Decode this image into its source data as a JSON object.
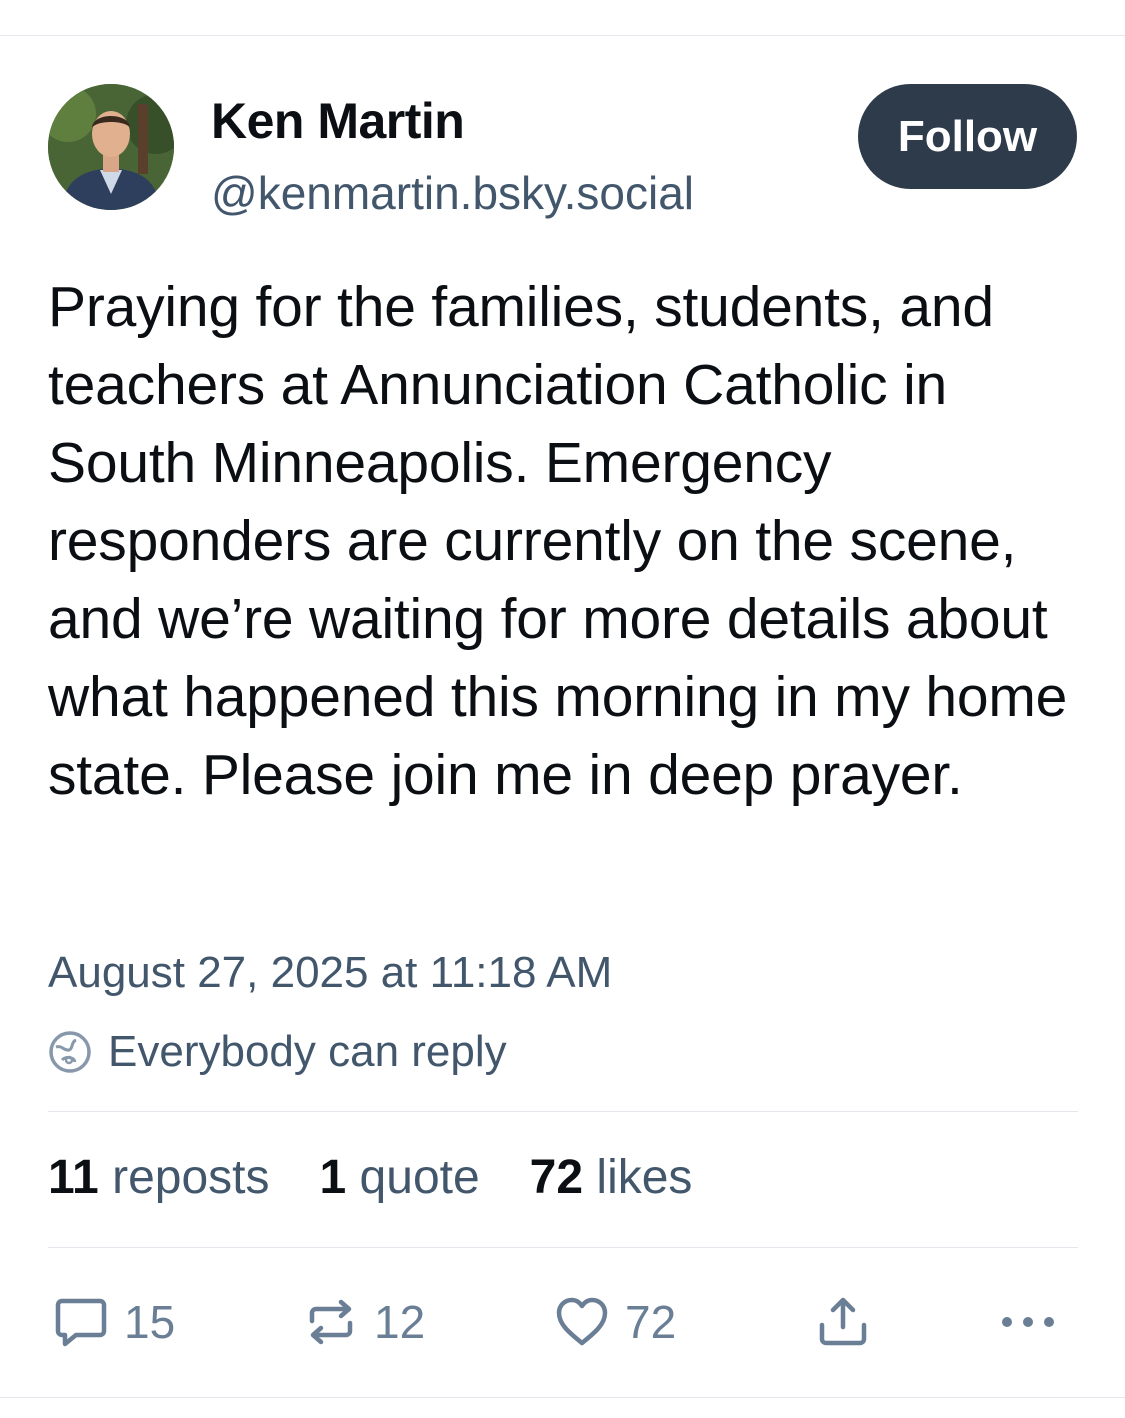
{
  "author": {
    "display_name": "Ken Martin",
    "handle": "@kenmartin.bsky.social",
    "avatar_icon": "profile-photo"
  },
  "follow_button": {
    "label": "Follow"
  },
  "post": {
    "text": "Praying for the families, students, and teachers at Annunciation Catholic in South Minneapolis. Emergency responders are currently on the scene, and we’re waiting for more details about what happened this morning in my home state. Please join me in deep prayer.",
    "timestamp": "August 27, 2025 at 11:18 AM",
    "reply_setting": "Everybody can reply",
    "reply_setting_icon": "globe-icon"
  },
  "stats": {
    "reposts_count": "11",
    "reposts_label": "reposts",
    "quotes_count": "1",
    "quotes_label": "quote",
    "likes_count": "72",
    "likes_label": "likes"
  },
  "actions": {
    "reply_count": "15",
    "repost_count": "12",
    "like_count": "72"
  },
  "colors": {
    "text_primary": "#0b0f14",
    "text_secondary": "#42576c",
    "icon": "#6a7f95",
    "follow_bg": "#2e3b4a",
    "divider": "#e4e7eb"
  }
}
